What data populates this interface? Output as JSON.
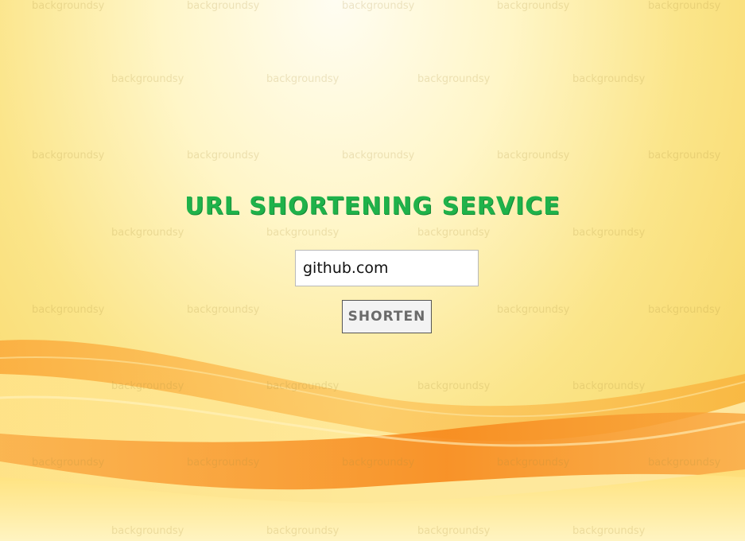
{
  "page": {
    "title": "URL SHORTENING SERVICE"
  },
  "form": {
    "url_value": "github.com",
    "shorten_label": "SHORTEN"
  },
  "background": {
    "watermark_text": "backgroundsy",
    "colors": {
      "title": "#1fb24a",
      "wave_orange": "#f7931e",
      "wave_yellow": "#ffe680"
    }
  }
}
